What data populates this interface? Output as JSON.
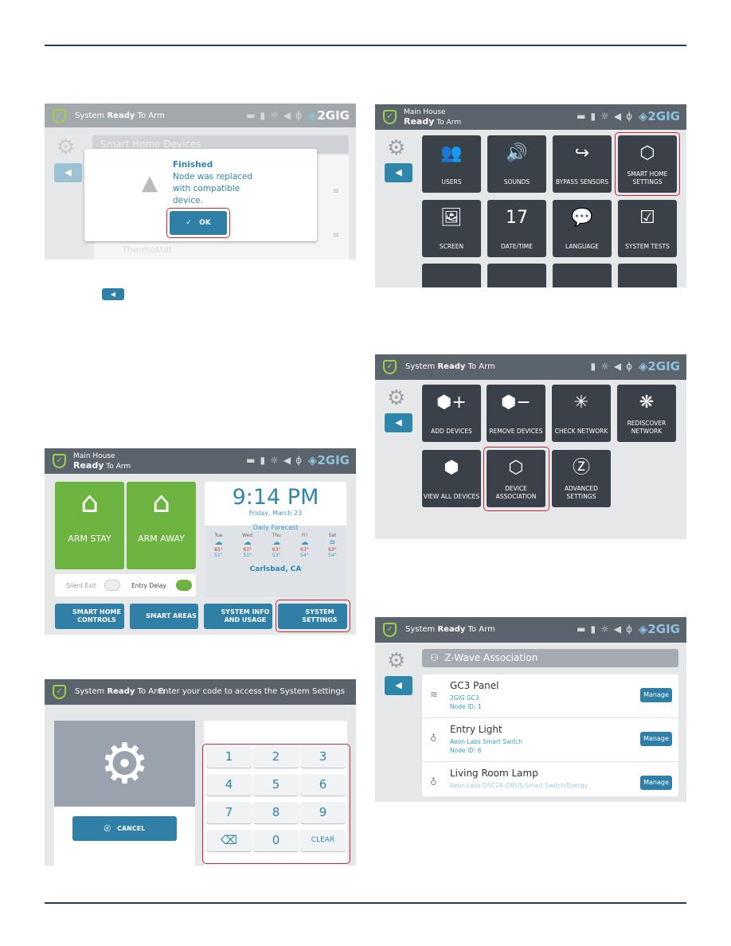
{
  "panel1": {
    "status_prefix": "System",
    "status_bold": "Ready",
    "status_suffix": "To Arm",
    "logo": "2GIG",
    "title": "Smart Home Devices",
    "dialog": {
      "title": "Finished",
      "message": "Node was replaced with compatible device.",
      "ok": "OK"
    },
    "faded_item": "Thermostat"
  },
  "panel2": {
    "line1": "Main House",
    "bold": "Ready",
    "suffix": "To Arm",
    "logo": "2GIG",
    "arm_stay": "ARM STAY",
    "arm_away": "ARM AWAY",
    "time": "9:14 PM",
    "date": "Friday, March 23",
    "forecast_title": "Daily Forecast",
    "forecast": [
      {
        "day": "Tue",
        "hi": "65°",
        "lo": "51°"
      },
      {
        "day": "Wed",
        "hi": "63°",
        "lo": "53°"
      },
      {
        "day": "Thu",
        "hi": "63°",
        "lo": "53°"
      },
      {
        "day": "Fri",
        "hi": "63°",
        "lo": "54°"
      },
      {
        "day": "Sat",
        "hi": "63°",
        "lo": "54°"
      }
    ],
    "location": "Carlsbad, CA",
    "silent_exit": "Silent Exit",
    "entry_delay": "Entry Delay",
    "silent_exit_on": false,
    "entry_delay_on": true,
    "buttons": [
      "SMART HOME CONTROLS",
      "SMART AREAS",
      "SYSTEM INFO AND USAGE",
      "SYSTEM SETTINGS"
    ]
  },
  "panel3": {
    "status_prefix": "System",
    "status_bold": "Ready",
    "status_suffix": "To Arm",
    "prompt": "Enter your code to access the System Settings",
    "cancel": "CANCEL",
    "keys": [
      "1",
      "2",
      "3",
      "4",
      "5",
      "6",
      "7",
      "8",
      "9",
      "⌫",
      "0",
      "CLEAR"
    ]
  },
  "panel4": {
    "line1": "Main House",
    "bold": "Ready",
    "suffix": "To Arm",
    "logo": "2GIG",
    "tiles": [
      {
        "label": "USERS",
        "icon": "👥"
      },
      {
        "label": "SOUNDS",
        "icon": "🔊"
      },
      {
        "label": "BYPASS SENSORS",
        "icon": "↪"
      },
      {
        "label": "SMART HOME SETTINGS",
        "icon": "⬡"
      },
      {
        "label": "SCREEN",
        "icon": "🖼"
      },
      {
        "label": "DATE/TIME",
        "icon": "17"
      },
      {
        "label": "LANGUAGE",
        "icon": "💬"
      },
      {
        "label": "SYSTEM TESTS",
        "icon": "☑"
      }
    ]
  },
  "panel5": {
    "status_prefix": "System",
    "status_bold": "Ready",
    "status_suffix": "To Arm",
    "logo": "2GIG",
    "tiles": [
      {
        "label": "ADD DEVICES",
        "icon": "⬢+"
      },
      {
        "label": "REMOVE DEVICES",
        "icon": "⬢−"
      },
      {
        "label": "CHECK NETWORK",
        "icon": "✳"
      },
      {
        "label": "REDISCOVER NETWORK",
        "icon": "❋"
      },
      {
        "label": "VIEW ALL DEVICES",
        "icon": "⬢"
      },
      {
        "label": "DEVICE ASSOCIATION",
        "icon": "⬡"
      },
      {
        "label": "ADVANCED SETTINGS",
        "icon": "Ⓩ"
      }
    ]
  },
  "panel6": {
    "status_prefix": "System",
    "status_bold": "Ready",
    "status_suffix": "To Arm",
    "logo": "2GIG",
    "title": "Z-Wave Association",
    "devices": [
      {
        "name": "GC3 Panel",
        "model": "2GIG GC3",
        "node": "Node ID: 1",
        "icon": "wifi",
        "action": "Manage"
      },
      {
        "name": "Entry Light",
        "model": "Aeon Labs Smart Switch",
        "node": "Node ID: 6",
        "icon": "bulb",
        "action": "Manage"
      },
      {
        "name": "Living Room Lamp",
        "model": "Aeon Labs DSC24-ZWUS Smart Switch/Energy",
        "node": "",
        "icon": "bulb",
        "action": "Manage"
      }
    ]
  },
  "colors": {
    "accent": "#2f7fa6",
    "highlight": "#c8283a",
    "header": "#5b636c",
    "arm_green": "#6cb33f",
    "rule": "#1f3d5c"
  }
}
